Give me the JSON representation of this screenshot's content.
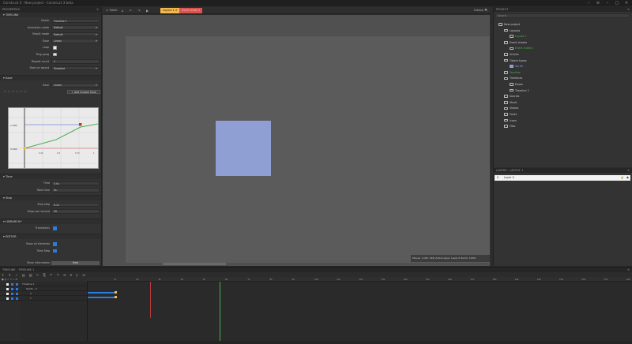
{
  "app": {
    "title": "Construct 3 - New project - Construct 3 beta",
    "controls": [
      "‹",
      "≡",
      "–",
      "□",
      "✕"
    ]
  },
  "properties": {
    "header": "PROPERTIES",
    "timeline_section": "TIMELINE",
    "timeline_rows": [
      {
        "label": "Name",
        "value": "Timeline 1",
        "kind": "text"
      },
      {
        "label": "Animation mode",
        "value": "Default",
        "kind": "select"
      },
      {
        "label": "Result mode",
        "value": "Default",
        "kind": "select"
      },
      {
        "label": "Ease",
        "value": "Linear",
        "kind": "select",
        "prefix": "Fwd"
      },
      {
        "label": "Loop",
        "value": "",
        "kind": "check"
      },
      {
        "label": "Ping pong",
        "value": "",
        "kind": "check"
      },
      {
        "label": "Repeat count",
        "value": "1",
        "kind": "text"
      },
      {
        "label": "Start on layout",
        "value": "Disabled",
        "kind": "select"
      }
    ],
    "ease_section": "Ease",
    "ease_row": {
      "label": "Ease",
      "value": "Linear"
    },
    "add_custom_ease": "+ Add Custom Ease",
    "graph_labels": {
      "y_top": "1.000",
      "y_bottom": "0.000",
      "x_ticks": [
        "0.25",
        "0.5",
        "0.75",
        "1"
      ]
    },
    "time_section": "Time",
    "time_rows": [
      {
        "label": "Time",
        "value": "0.0s"
      },
      {
        "label": "Total time",
        "value": "5s"
      }
    ],
    "step_section": "Step",
    "step_rows": [
      {
        "label": "Step step",
        "value": "0.1s"
      },
      {
        "label": "Steps per second",
        "value": "30"
      }
    ],
    "hierarchy_section": "HIERARCHY",
    "hierarchy_rows": [
      {
        "label": "Transforms",
        "value": ""
      }
    ],
    "editor_section": "EDITOR",
    "editor_rows": [
      {
        "label": "Show all elements",
        "value": ""
      },
      {
        "label": "Time Step",
        "value": ""
      }
    ],
    "show_information": {
      "label": "Show information",
      "value": "Help"
    }
  },
  "layout_view": {
    "tabs": [
      {
        "label": "Layout 1",
        "active": true
      },
      {
        "label": "Event sheet 1",
        "active": false
      }
    ],
    "toolbar_left": "Tablet",
    "toolbar_right": "Sidebar",
    "status": "Mouse: (-193, 319)   Active layer: Layer 0   Zoom: 100%"
  },
  "project": {
    "header": "PROJECT",
    "search_placeholder": "Search",
    "tree": [
      {
        "label": "New project",
        "depth": 0,
        "kind": "project"
      },
      {
        "label": "Layouts",
        "depth": 1,
        "kind": "folder"
      },
      {
        "label": "Layout 1",
        "depth": 2,
        "kind": "layout"
      },
      {
        "label": "Event sheets",
        "depth": 1,
        "kind": "folder"
      },
      {
        "label": "Event sheet 1",
        "depth": 2,
        "kind": "event"
      },
      {
        "label": "Scripts",
        "depth": 1,
        "kind": "folder"
      },
      {
        "label": "Object types",
        "depth": 1,
        "kind": "folder"
      },
      {
        "label": "Sprite",
        "depth": 2,
        "kind": "sprite"
      },
      {
        "label": "Families",
        "depth": 1,
        "kind": "family"
      },
      {
        "label": "Timelines",
        "depth": 1,
        "kind": "folder"
      },
      {
        "label": "Eases",
        "depth": 2,
        "kind": "folder"
      },
      {
        "label": "Timeline 1",
        "depth": 2,
        "kind": "timeline"
      },
      {
        "label": "Sounds",
        "depth": 1,
        "kind": "folder"
      },
      {
        "label": "Music",
        "depth": 1,
        "kind": "folder"
      },
      {
        "label": "Videos",
        "depth": 1,
        "kind": "folder"
      },
      {
        "label": "Fonts",
        "depth": 1,
        "kind": "folder"
      },
      {
        "label": "Icons",
        "depth": 1,
        "kind": "folder"
      },
      {
        "label": "Files",
        "depth": 1,
        "kind": "folder"
      }
    ]
  },
  "layers": {
    "header": "LAYERS - LAYOUT 1",
    "items": [
      {
        "label": "Layer 0",
        "index": "0"
      }
    ]
  },
  "timeline": {
    "header": "TIMELINE - TIMELINE 1",
    "tracks": [
      {
        "label": "Timeline 1",
        "depth": 0
      },
      {
        "label": "Sprite - 2",
        "depth": 1
      },
      {
        "label": "X",
        "depth": 2
      },
      {
        "label": "Y",
        "depth": 2
      }
    ],
    "ruler": [
      "1s",
      "2s",
      "3s",
      "4s",
      "5s",
      "6s",
      "7s",
      "8s",
      "9s",
      "10s",
      "11s",
      "12s",
      "13s",
      "14s",
      "15s",
      "16s",
      "17s",
      "18s",
      "19s",
      "20s",
      "21s",
      "22s",
      "23s",
      "24s"
    ]
  },
  "colors": {
    "accent": "#2a7de1",
    "sprite": "#8f9ed3",
    "tab_active": "#f2b84b",
    "tab_inactive": "#d9534f",
    "green": "#4caf50",
    "red": "#b33a3a"
  }
}
